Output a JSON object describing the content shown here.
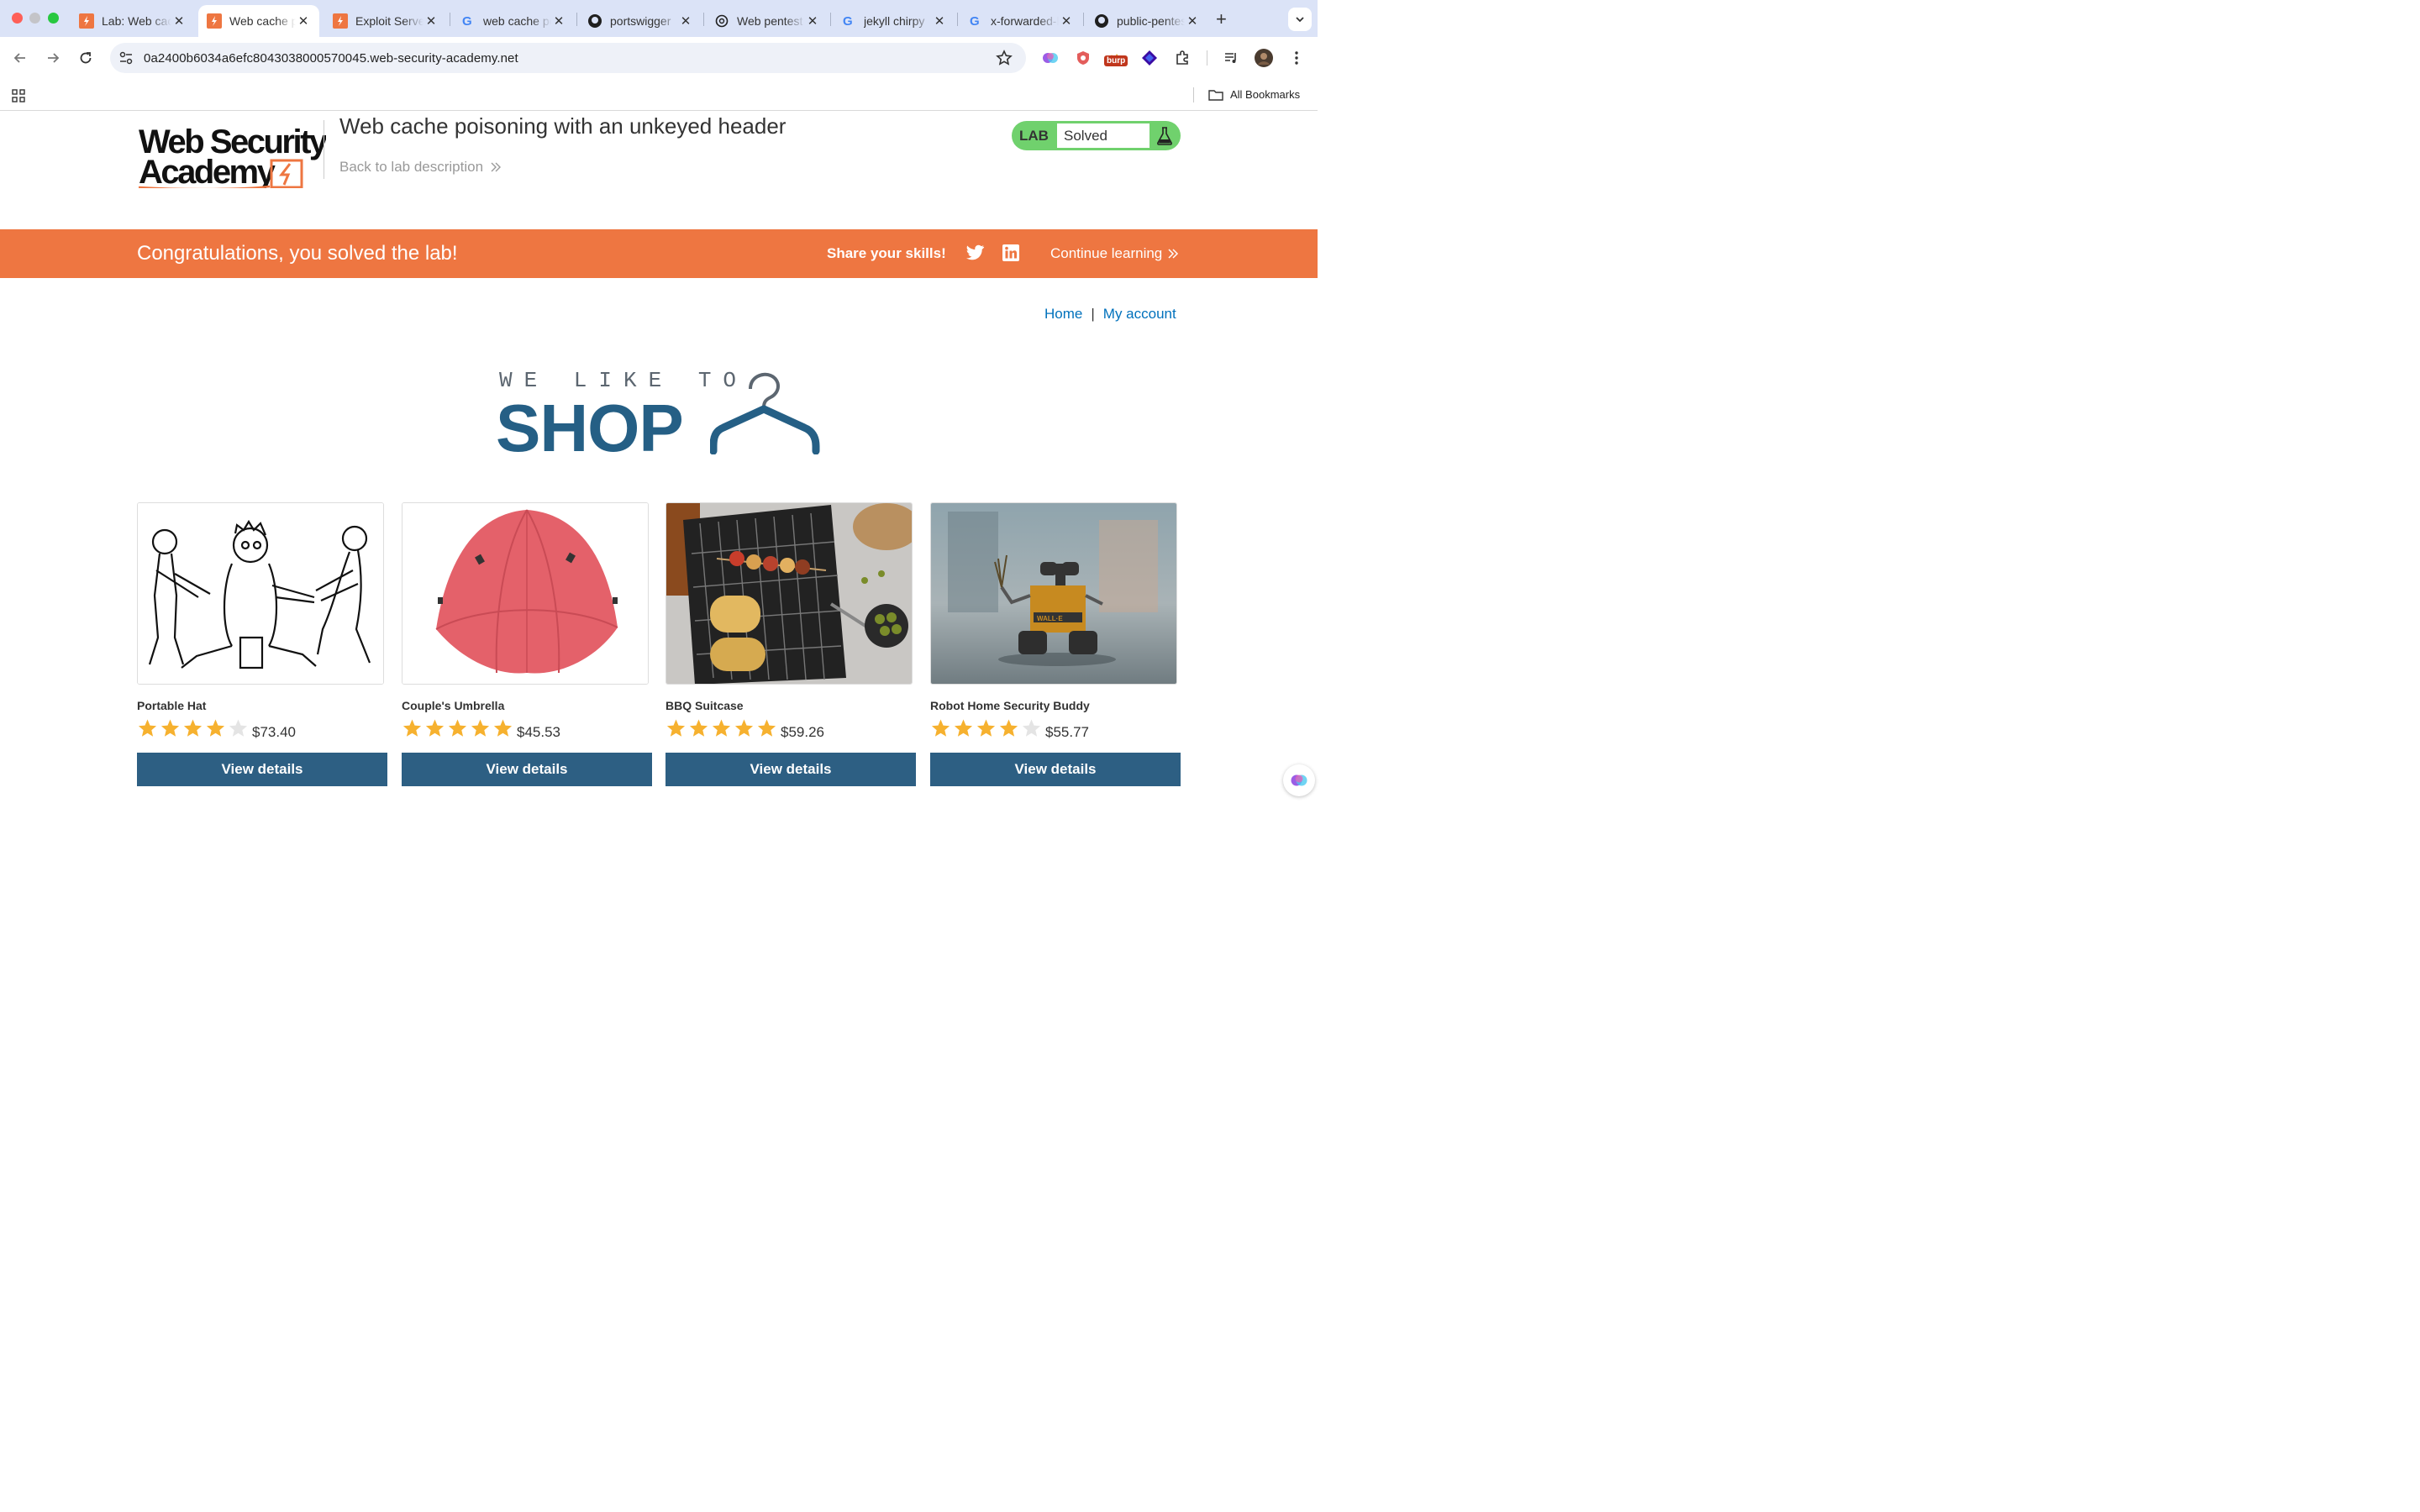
{
  "browser": {
    "tabs": [
      {
        "title": "Lab: Web cache poisoning",
        "favicon": "portswigger-icon"
      },
      {
        "title": "Web cache poisoning",
        "favicon": "portswigger-icon",
        "active": true
      },
      {
        "title": "Exploit Server",
        "favicon": "portswigger-icon"
      },
      {
        "title": "web cache poisoning",
        "favicon": "google-icon"
      },
      {
        "title": "portswigger",
        "favicon": "github-icon"
      },
      {
        "title": "Web pentest",
        "favicon": "openai-icon"
      },
      {
        "title": "jekyll chirpy",
        "favicon": "google-icon"
      },
      {
        "title": "x-forwarded-host",
        "favicon": "google-icon"
      },
      {
        "title": "public-pentest",
        "favicon": "github-icon"
      }
    ],
    "url": "0a2400b6034a6efc8043038000570045.web-security-academy.net",
    "burp_badge": "burp",
    "all_bookmarks": "All Bookmarks"
  },
  "lab": {
    "logo_line1": "Web Security",
    "logo_line2": "Academy",
    "title": "Web cache poisoning with an unkeyed header",
    "back_link": "Back to lab description",
    "status_label": "LAB",
    "status_value": "Solved",
    "status_color": "#70d16d"
  },
  "banner": {
    "message": "Congratulations, you solved the lab!",
    "share": "Share your skills!",
    "continue": "Continue learning",
    "color": "#ee7641"
  },
  "nav": {
    "home": "Home",
    "separator": "|",
    "account": "My account"
  },
  "hero": {
    "small": "WE LIKE TO",
    "big": "SHOP"
  },
  "products": [
    {
      "name": "Portable Hat",
      "price": "$73.40",
      "stars": 4,
      "button": "View details"
    },
    {
      "name": "Couple's Umbrella",
      "price": "$45.53",
      "stars": 5,
      "button": "View details"
    },
    {
      "name": "BBQ Suitcase",
      "price": "$59.26",
      "stars": 5,
      "button": "View details"
    },
    {
      "name": "Robot Home Security Buddy",
      "price": "$55.77",
      "stars": 4,
      "button": "View details"
    }
  ]
}
